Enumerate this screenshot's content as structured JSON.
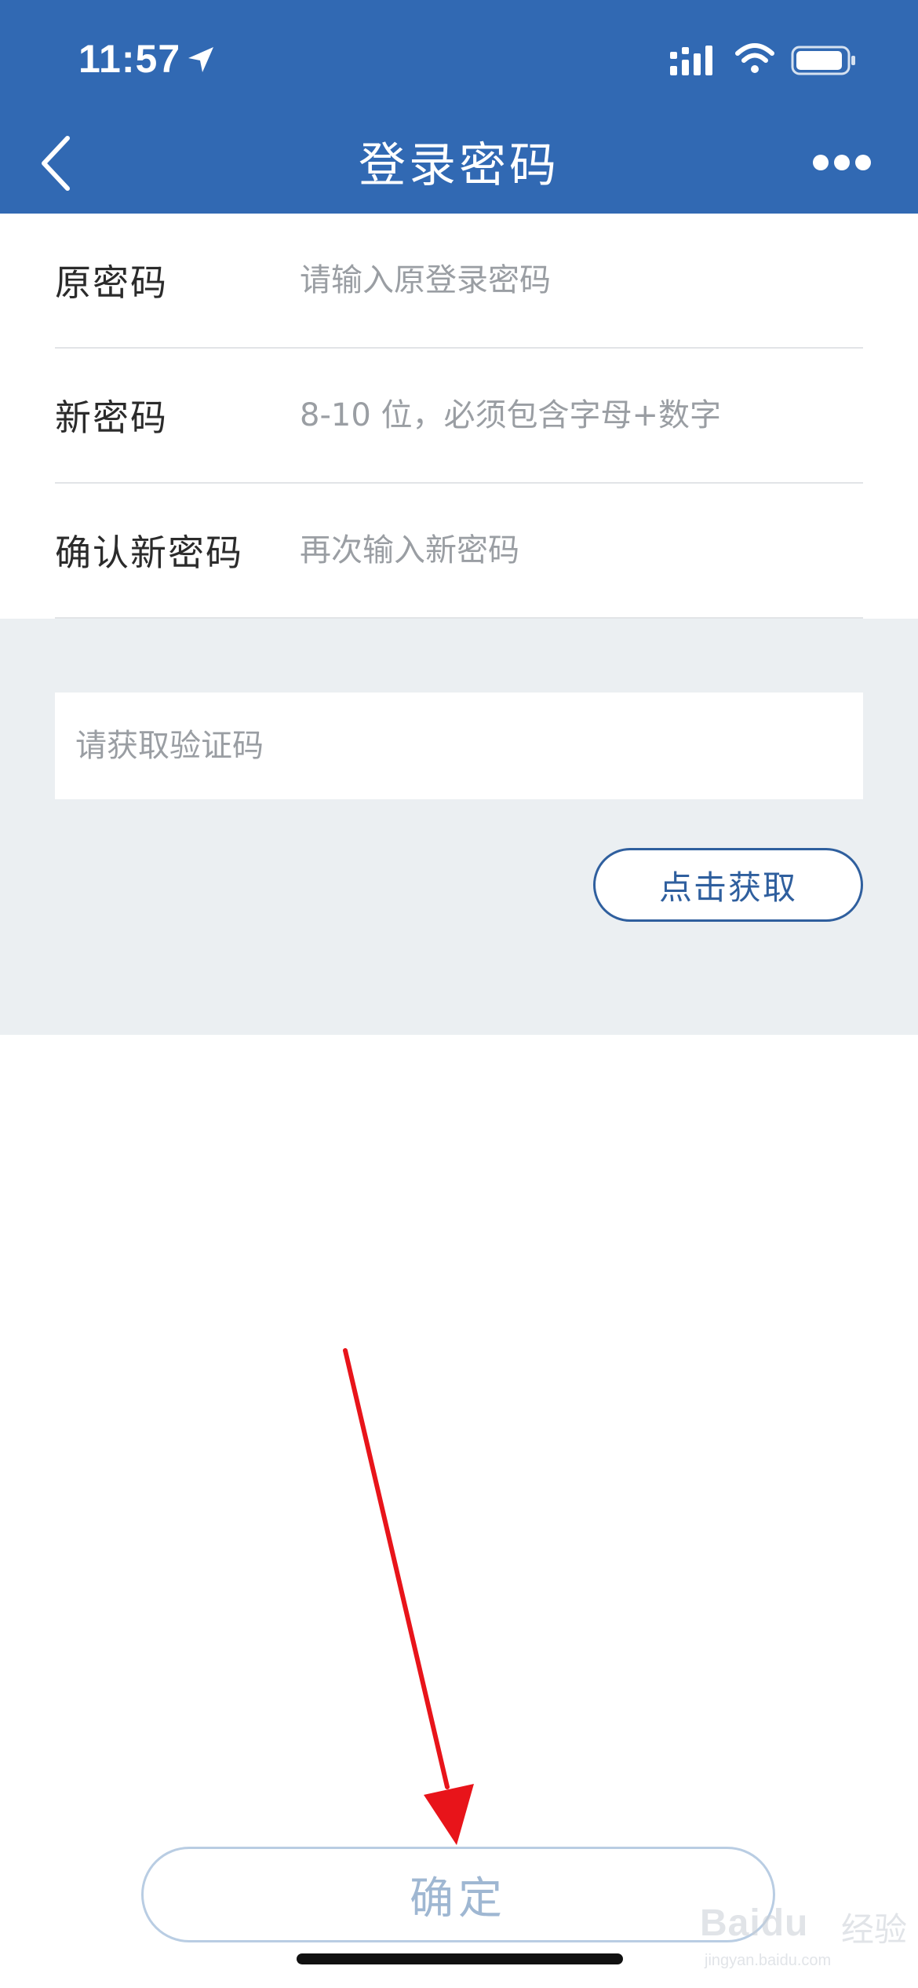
{
  "status_bar": {
    "time": "11:57",
    "icons": [
      "location-arrow-icon",
      "cellular-signal-icon",
      "wifi-icon",
      "battery-icon"
    ]
  },
  "nav": {
    "title": "登录密码",
    "back_icon": "chevron-left-icon",
    "more_icon": "more-dots-icon"
  },
  "form": {
    "rows": [
      {
        "label": "原密码",
        "placeholder": "请输入原登录密码"
      },
      {
        "label": "新密码",
        "placeholder": "8-10 位，必须包含字母+数字"
      },
      {
        "label": "确认新密码",
        "placeholder": "再次输入新密码"
      }
    ]
  },
  "verification": {
    "placeholder": "请获取验证码",
    "button_label": "点击获取"
  },
  "confirm_button": "确定",
  "watermark": {
    "brand": "Baidu",
    "chinese": "经验",
    "url": "jingyan.baidu.com"
  },
  "colors": {
    "header_bg": "#3169b3",
    "accent": "#2f5f9e",
    "section_bg": "#ebeff2",
    "confirm_disabled": "#9fb7d2",
    "annotation": "#e8141a"
  }
}
